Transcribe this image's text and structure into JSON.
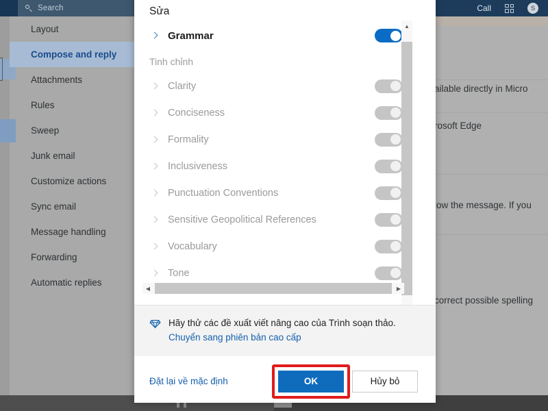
{
  "topbar": {
    "search_placeholder": "Search",
    "search_icon": "search-icon",
    "call_label": "Call",
    "grid_icon": "app-grid-icon",
    "avatar_initial": "S"
  },
  "sidebar": {
    "items": [
      {
        "label": "Layout",
        "selected": false
      },
      {
        "label": "Compose and reply",
        "selected": true
      },
      {
        "label": "Attachments",
        "selected": false
      },
      {
        "label": "Rules",
        "selected": false
      },
      {
        "label": "Sweep",
        "selected": false
      },
      {
        "label": "Junk email",
        "selected": false
      },
      {
        "label": "Customize actions",
        "selected": false
      },
      {
        "label": "Sync email",
        "selected": false
      },
      {
        "label": "Message handling",
        "selected": false
      },
      {
        "label": "Forwarding",
        "selected": false
      },
      {
        "label": "Automatic replies",
        "selected": false
      }
    ]
  },
  "background_content": {
    "lines": [
      "ailable directly in Micro",
      "rosoft Edge",
      "low the message. If you",
      "correct possible spelling"
    ]
  },
  "dialog": {
    "title": "Sửa",
    "main_option": {
      "label": "Grammar",
      "enabled": true,
      "chevron_icon": "chevron-right-icon"
    },
    "group_heading": "Tinh chỉnh",
    "options": [
      {
        "label": "Clarity",
        "enabled": false
      },
      {
        "label": "Conciseness",
        "enabled": false
      },
      {
        "label": "Formality",
        "enabled": false
      },
      {
        "label": "Inclusiveness",
        "enabled": false
      },
      {
        "label": "Punctuation Conventions",
        "enabled": false
      },
      {
        "label": "Sensitive Geopolitical References",
        "enabled": false
      },
      {
        "label": "Vocabulary",
        "enabled": false
      },
      {
        "label": "Tone",
        "enabled": false
      }
    ],
    "promo": {
      "icon": "diamond-icon",
      "text": "Hãy thử các đề xuất viết nâng cao của Trình soạn thảo. ",
      "link": "Chuyển sang phiên bản cao cấp"
    },
    "reset_label": "Đặt lại về mặc định",
    "ok_label": "OK",
    "cancel_label": "Hủy bỏ",
    "scrollbar": {
      "up_arrow": "▲",
      "down_arrow": "▼",
      "left_arrow": "◀",
      "right_arrow": "▶"
    }
  },
  "annotation": {
    "highlight_color": "#e01b1b",
    "target": "ok-button"
  }
}
